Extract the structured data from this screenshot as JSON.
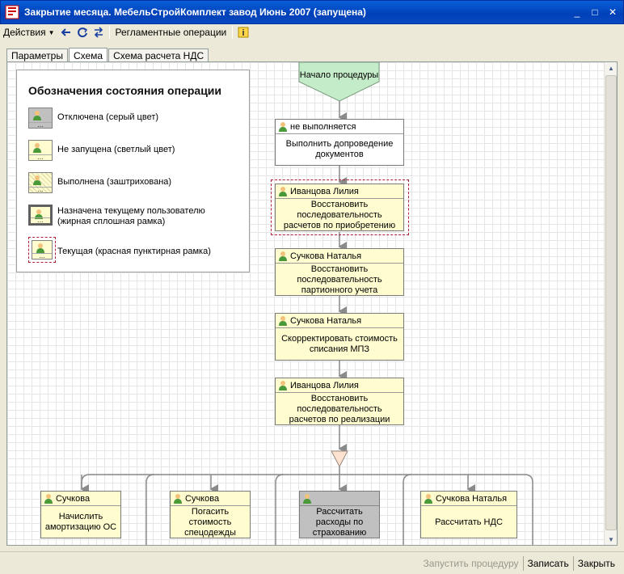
{
  "window": {
    "title": "Закрытие месяца. МебельСтройКомплект завод Июнь 2007 (запущена)",
    "controls": {
      "minimize": "_",
      "maximize": "□",
      "close": "✕"
    }
  },
  "toolbar": {
    "actions_label": "Действия",
    "reglament_label": "Регламентные операции",
    "icons": [
      "arrow-left-icon",
      "refresh-icon",
      "swap-icon",
      "info-icon"
    ]
  },
  "tabs": [
    {
      "label": "Параметры",
      "active": false
    },
    {
      "label": "Схема",
      "active": true
    },
    {
      "label": "Схема расчета НДС",
      "active": false
    }
  ],
  "legend": {
    "title": "Обозначения состояния операции",
    "items": [
      {
        "label": "Отключена (серый цвет)"
      },
      {
        "label": "Не запущена (светлый цвет)"
      },
      {
        "label": "Выполнена (заштрихована)"
      },
      {
        "label": "Назначена текущему пользователю (жирная сплошная рамка)"
      },
      {
        "label": "Текущая (красная пунктирная рамка)"
      }
    ]
  },
  "flow": {
    "start": {
      "label": "Начало процедуры"
    },
    "nodes": [
      {
        "user": "не выполняется",
        "text": "Выполнить допроведение документов",
        "state": "white"
      },
      {
        "user": "Иванцова Лилия",
        "text": "Восстановить последовательность расчетов по приобретению",
        "state": "current"
      },
      {
        "user": "Сучкова Наталья",
        "text": "Восстановить последовательность партионного учета",
        "state": "normal"
      },
      {
        "user": "Сучкова Наталья",
        "text": "Скорректировать стоимость списания МПЗ",
        "state": "normal"
      },
      {
        "user": "Иванцова Лилия",
        "text": "Восстановить последовательность расчетов по реализации",
        "state": "normal"
      }
    ],
    "branches": [
      {
        "user": "Сучкова",
        "text": "Начислить амортизацию ОС",
        "state": "normal"
      },
      {
        "user": "Сучкова",
        "text": "Погасить стоимость спецодежды",
        "state": "normal"
      },
      {
        "user": "",
        "text": "Рассчитать расходы по страхованию",
        "state": "gray"
      },
      {
        "user": "Сучкова Наталья",
        "text": "Рассчитать НДС",
        "state": "normal"
      }
    ],
    "more_marker": "..."
  },
  "footer": {
    "run_label": "Запустить процедуру",
    "save_label": "Записать",
    "close_label": "Закрыть"
  },
  "colors": {
    "title_bar": "#0a4fce",
    "node_fill": "#fffccf",
    "start_fill": "#c5ecc9",
    "current_frame": "#b0203a",
    "disabled_fill": "#c0c0c0"
  }
}
